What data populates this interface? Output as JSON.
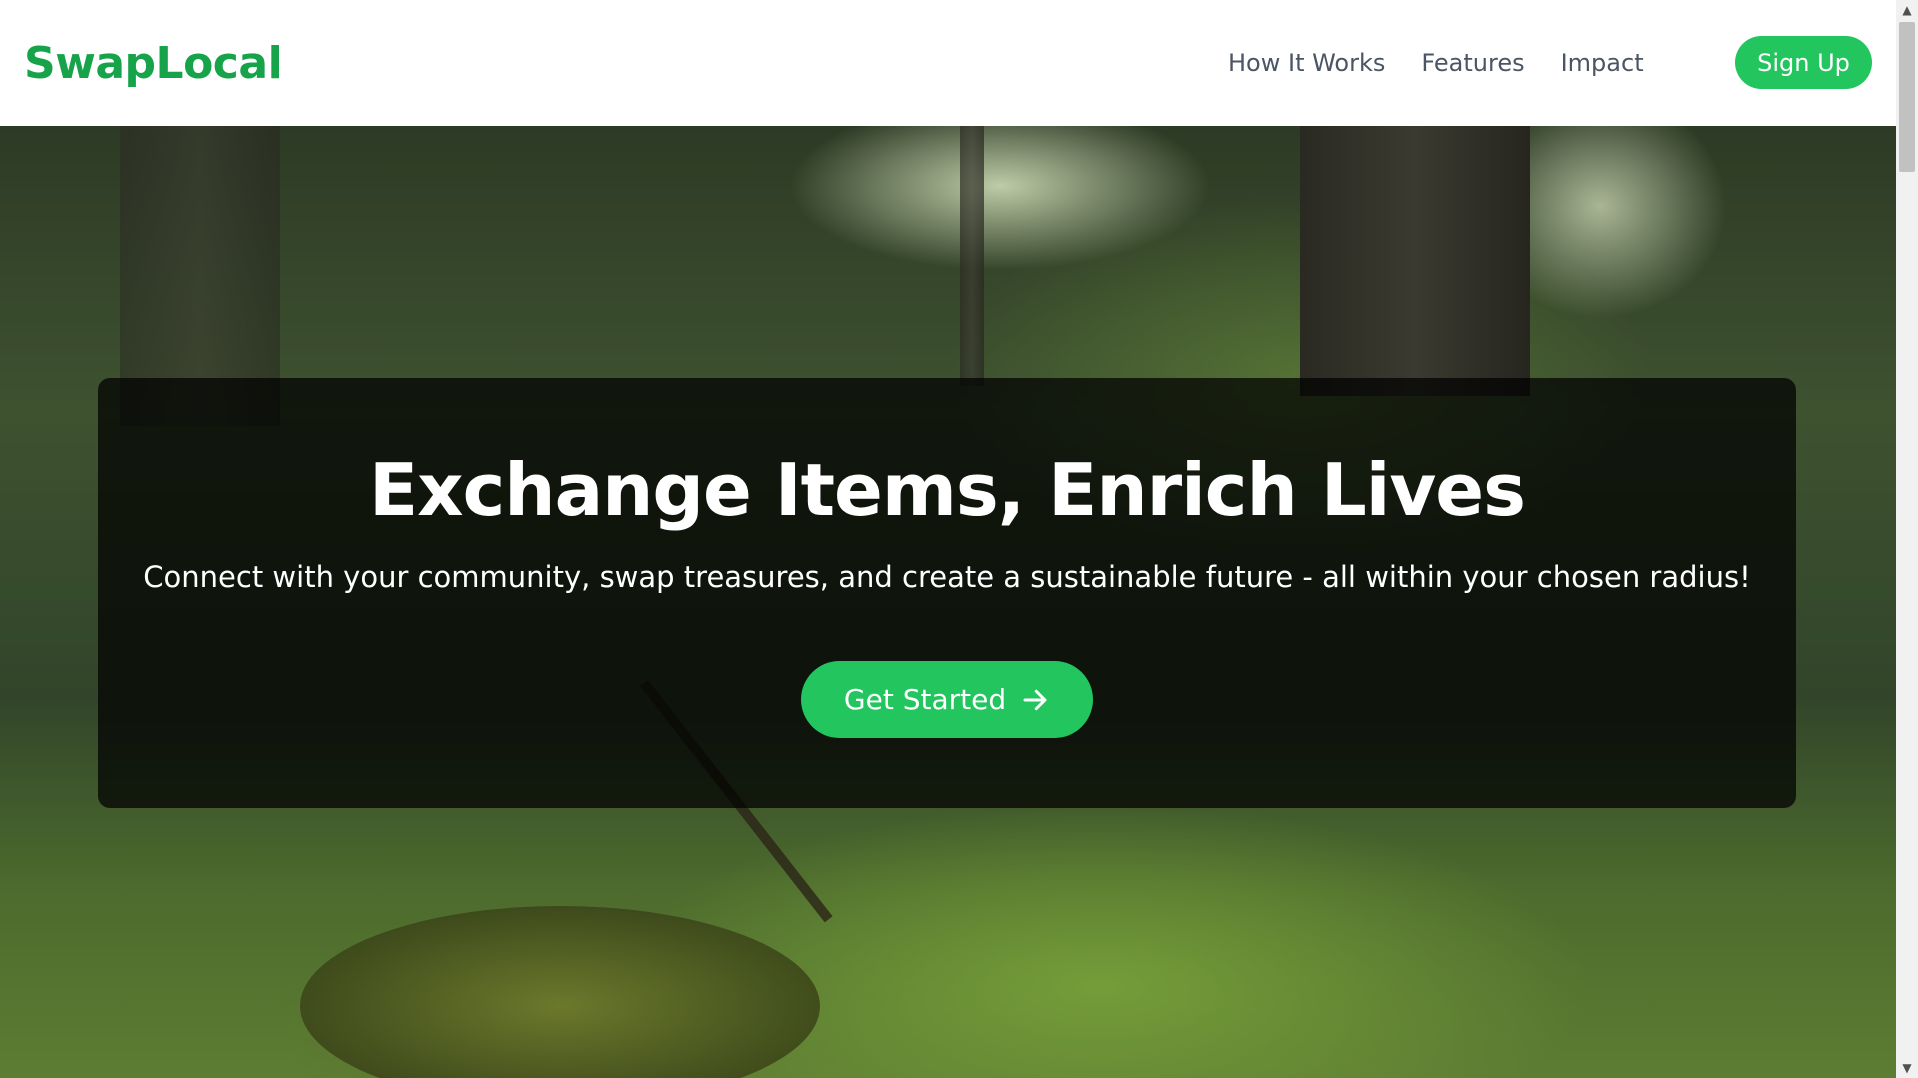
{
  "header": {
    "logo": "SwapLocal",
    "nav": [
      "How It Works",
      "Features",
      "Impact"
    ],
    "signup_label": "Sign Up"
  },
  "hero": {
    "title": "Exchange Items, Enrich Lives",
    "subtitle": "Connect with your community, swap treasures, and create a sustainable future - all within your chosen radius!",
    "cta_label": "Get Started",
    "cta_icon": "arrow-right-icon"
  },
  "colors": {
    "brand": "#16a34a",
    "button": "#22c55e",
    "nav_text": "#4b5563"
  }
}
